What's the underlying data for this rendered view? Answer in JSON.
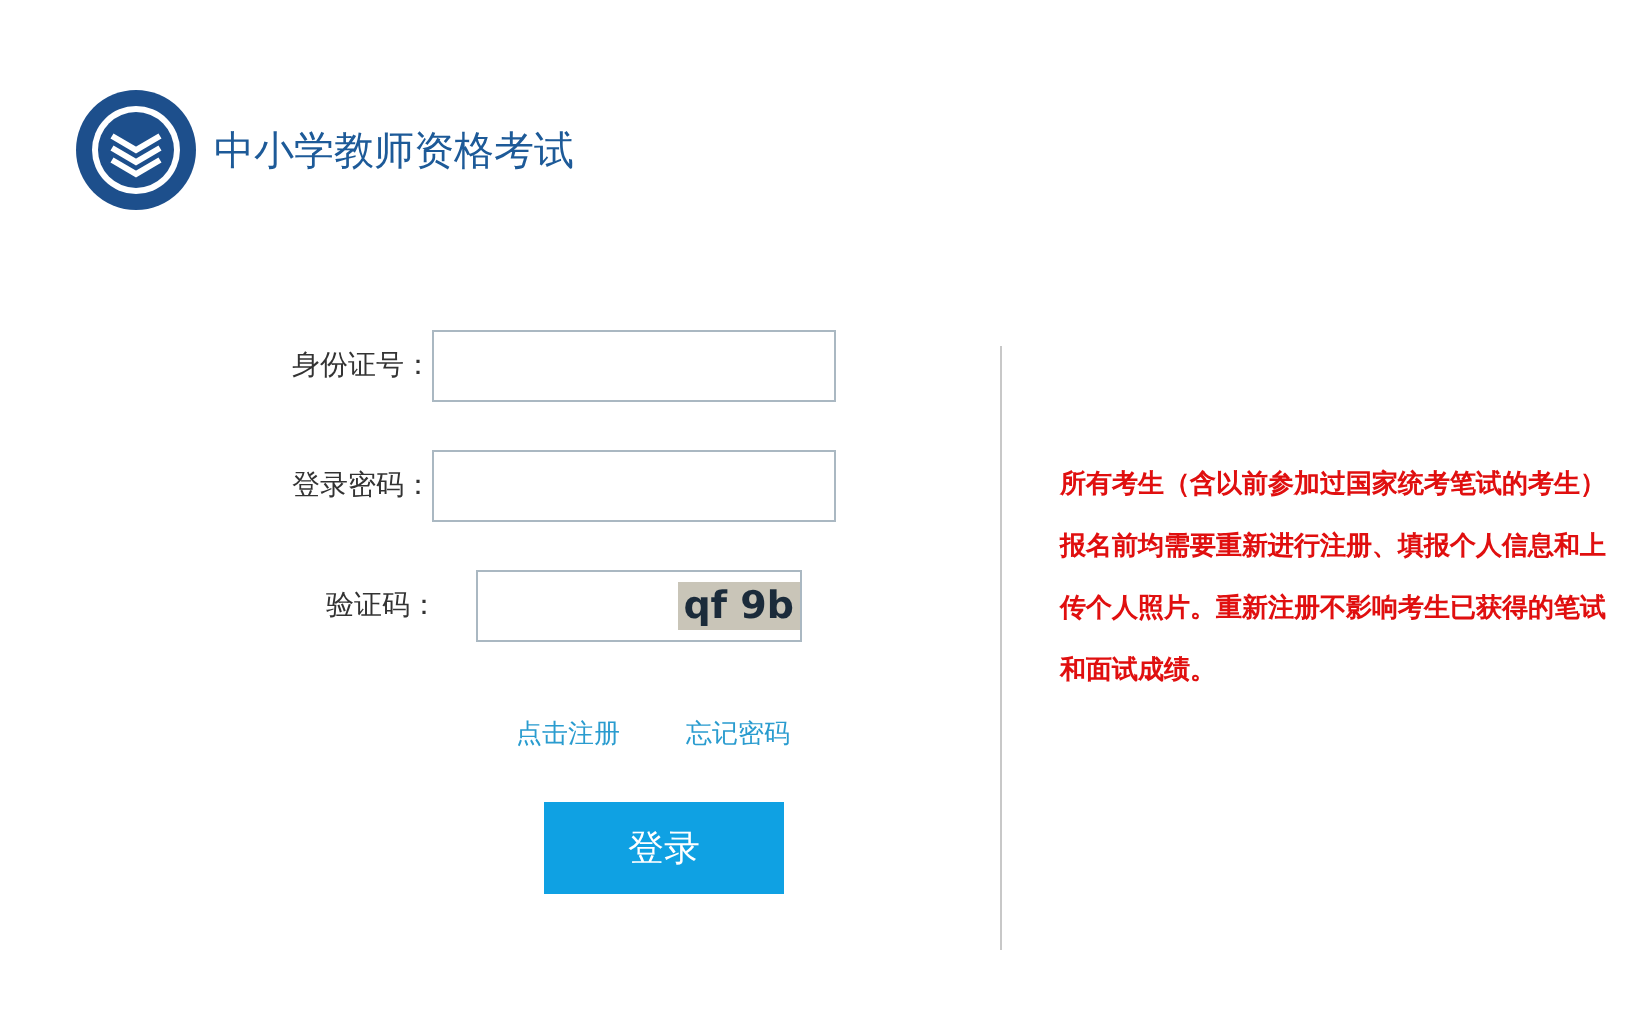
{
  "header": {
    "title": "中小学教师资格考试"
  },
  "login_form": {
    "fields": [
      {
        "kind": "text",
        "label": "身份证号："
      },
      {
        "kind": "text",
        "label": "登录密码："
      },
      {
        "kind": "captcha",
        "label": "验证码：",
        "captcha": "qf 9b"
      }
    ],
    "links": [
      "点击注册",
      "忘记密码"
    ],
    "submit": "登录"
  },
  "notice": "所有考生（含以前参加过国家统考笔试的考生）报名前均需要重新进行注册、填报个人信息和上传个人照片。重新注册不影响考生已获得的笔试和面试成绩。"
}
